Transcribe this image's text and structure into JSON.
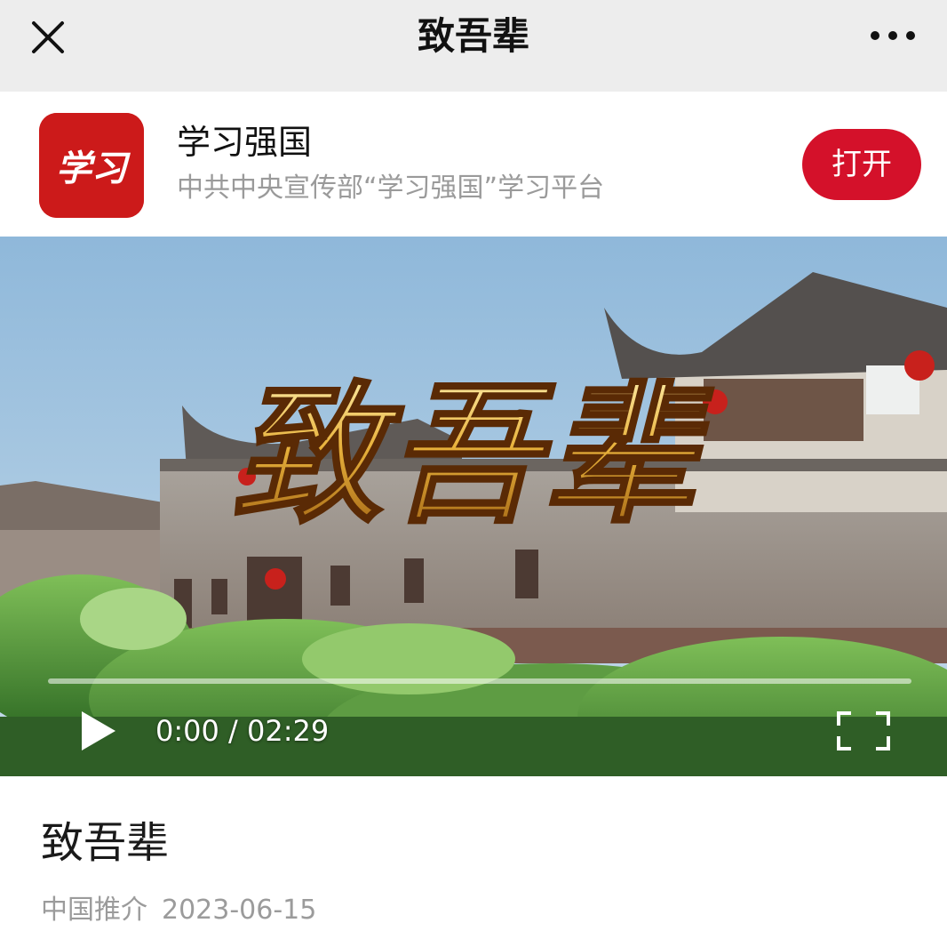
{
  "nav": {
    "title": "致吾辈",
    "close_icon": "close-icon",
    "more_icon": "more-icon"
  },
  "app_banner": {
    "name": "学习强国",
    "description": "中共中央宣传部“学习强国”学习平台",
    "open_label": "打开",
    "icon_text": "学习",
    "icon_color": "#cc1a1a",
    "button_color": "#d4112a"
  },
  "video": {
    "overlay_title": "致吾辈",
    "current_time": "0:00",
    "separator": "/",
    "duration": "02:29",
    "progress": 0,
    "play_icon": "play-icon",
    "fullscreen_icon": "fullscreen-icon"
  },
  "article": {
    "title": "致吾辈",
    "source": "中国推介",
    "date": "2023-06-15"
  }
}
